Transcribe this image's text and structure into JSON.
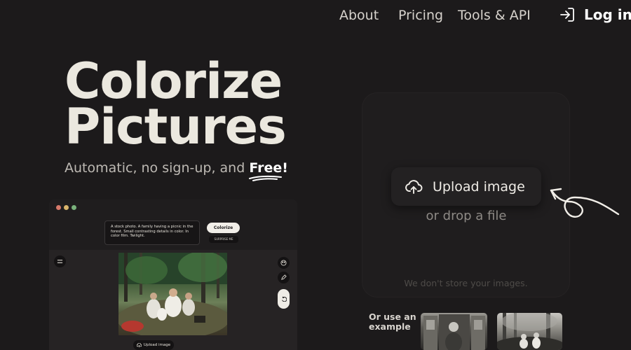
{
  "nav": {
    "about": "About",
    "pricing": "Pricing",
    "tools": "Tools & API",
    "login": "Log in"
  },
  "hero": {
    "title_line1": "Colorize",
    "title_line2": "Pictures",
    "subtitle_prefix": "Automatic, no sign-up, and ",
    "subtitle_emphasis": "Free!"
  },
  "mock_app": {
    "prompt": "A stock photo. A family having a picnic in the forest. Small contrasting details in color. In color film. Twilight.",
    "colorize_label": "Colorize",
    "surprise_label": "SURPRISE ME",
    "upload_label": "Upload image"
  },
  "upload": {
    "button_label": "Upload image",
    "drop_text": "or drop a file",
    "privacy_note": "We don't store your images."
  },
  "examples": {
    "label": "Or use an example"
  },
  "colors": {
    "background": "#1c1a1b",
    "card": "#1f1d1e",
    "text_primary": "#ebe8df",
    "accent_button": "#f1eee8"
  }
}
